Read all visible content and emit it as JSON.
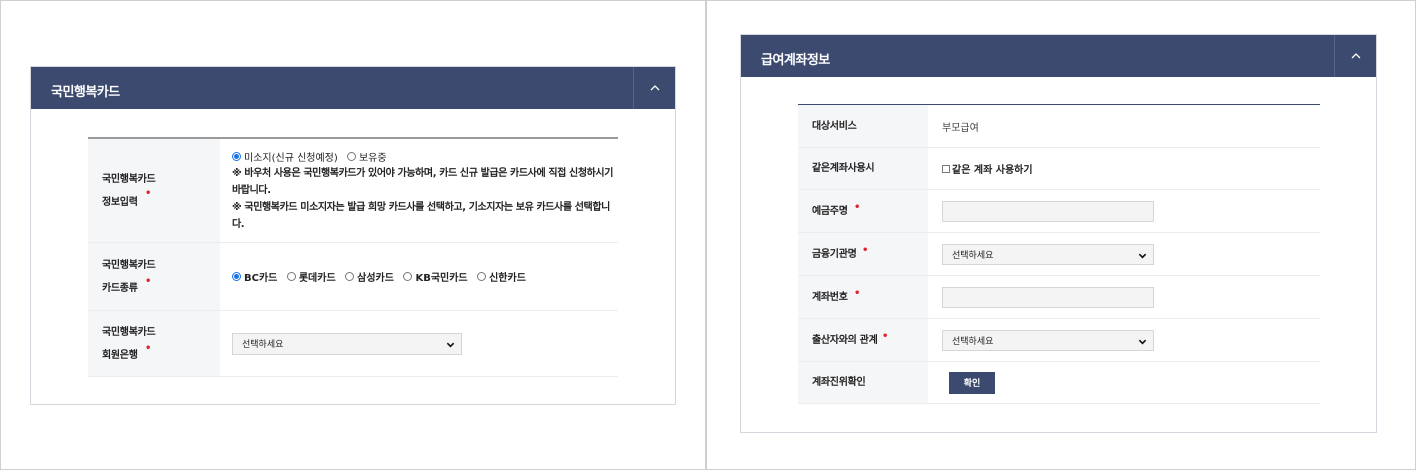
{
  "left_panel": {
    "title": "국민행복카드",
    "rows": [
      {
        "label_line1": "국민행복카드",
        "label_line2": "정보입력",
        "radios": [
          {
            "label": "미소지(신규 신청예정)",
            "checked": true
          },
          {
            "label": "보유중",
            "checked": false
          }
        ],
        "note1_a": "※ 바우처 사용은 국민행복카드가 있어야 가능하며, 카드 신규 발급은 카드사에 직접 신청하시기",
        "note1_b": "바랍니다.",
        "note2_a": "※ 국민행복카드 미소지자는 발급 희망 카드사를 선택하고, 기소지자는 보유 카드사를 선택합니",
        "note2_b": "다."
      },
      {
        "label_line1": "국민행복카드",
        "label_line2": "카드종류",
        "radios": [
          {
            "label": "BC카드",
            "checked": true
          },
          {
            "label": "롯데카드",
            "checked": false
          },
          {
            "label": "삼성카드",
            "checked": false
          },
          {
            "label": "KB국민카드",
            "checked": false
          },
          {
            "label": "신한카드",
            "checked": false
          }
        ]
      },
      {
        "label_line1": "국민행복카드",
        "label_line2": "회원은행",
        "select_value": "선택하세요"
      }
    ]
  },
  "right_panel": {
    "title": "급여계좌정보",
    "rows": {
      "service_label": "대상서비스",
      "service_value": "부모급여",
      "same_account_label": "같은계좌사용시",
      "same_account_checkbox": "같은 계좌 사용하기",
      "depositor_label": "예금주명",
      "bank_label": "금융기관명",
      "bank_select": "선택하세요",
      "account_label": "계좌번호",
      "relation_label": "출산자와의 관계",
      "relation_select": "선택하세요",
      "verify_label": "계좌진위확인",
      "verify_button": "확인"
    }
  },
  "required_mark": "•",
  "colors": {
    "header_bg": "#3c4a70",
    "required": "#e0232f",
    "radio_on": "#1a73e8"
  }
}
